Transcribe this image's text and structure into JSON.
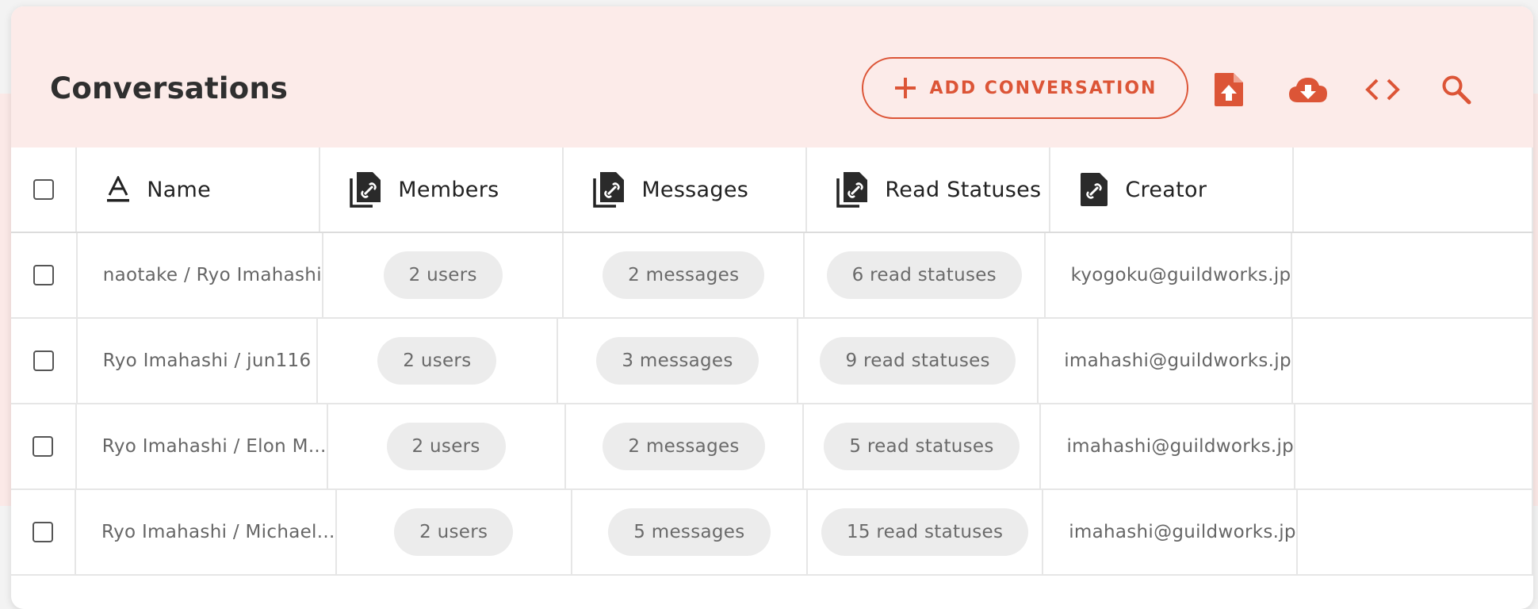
{
  "header": {
    "title": "Conversations",
    "add_button_label": "ADD CONVERSATION",
    "icons": [
      "upload-file-icon",
      "cloud-download-icon",
      "code-icon",
      "search-icon"
    ],
    "accent_color": "#dc5537"
  },
  "columns": [
    {
      "label": "Name",
      "icon": "text-format-icon"
    },
    {
      "label": "Members",
      "icon": "linked-files-icon"
    },
    {
      "label": "Messages",
      "icon": "linked-files-icon"
    },
    {
      "label": "Read Statuses",
      "icon": "linked-files-icon"
    },
    {
      "label": "Creator",
      "icon": "linked-file-icon"
    }
  ],
  "rows": [
    {
      "name": "naotake / Ryo Imahashi",
      "members": "2 users",
      "messages": "2 messages",
      "read_statuses": "6 read statuses",
      "creator": "kyogoku@guildworks.jp"
    },
    {
      "name": "Ryo Imahashi / jun116",
      "members": "2 users",
      "messages": "3 messages",
      "read_statuses": "9 read statuses",
      "creator": "imahashi@guildworks.jp"
    },
    {
      "name": "Ryo Imahashi / Elon M...",
      "members": "2 users",
      "messages": "2 messages",
      "read_statuses": "5 read statuses",
      "creator": "imahashi@guildworks.jp"
    },
    {
      "name": "Ryo Imahashi / Michael...",
      "members": "2 users",
      "messages": "5 messages",
      "read_statuses": "15 read statuses",
      "creator": "imahashi@guildworks.jp"
    }
  ]
}
